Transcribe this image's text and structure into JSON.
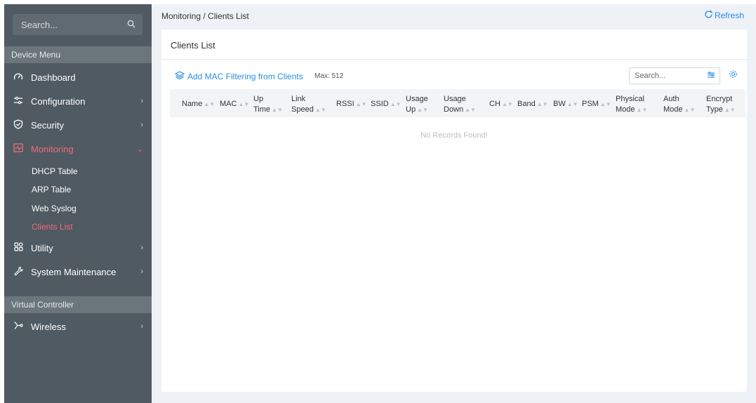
{
  "sidebar": {
    "search_placeholder": "Search...",
    "section_device": "Device Menu",
    "section_virtual": "Virtual Controller",
    "items": [
      {
        "label": "Dashboard",
        "icon": "dashboard-icon"
      },
      {
        "label": "Configuration",
        "icon": "sliders-icon"
      },
      {
        "label": "Security",
        "icon": "shield-icon"
      },
      {
        "label": "Monitoring",
        "icon": "monitor-icon"
      },
      {
        "label": "Utility",
        "icon": "grid-icon"
      },
      {
        "label": "System Maintenance",
        "icon": "wrench-icon"
      },
      {
        "label": "Wireless",
        "icon": "network-icon"
      }
    ],
    "subitems": [
      "DHCP Table",
      "ARP Table",
      "Web Syslog",
      "Clients List"
    ]
  },
  "header": {
    "breadcrumb": "Monitoring / Clients List",
    "refresh": "Refresh"
  },
  "panel": {
    "title": "Clients List",
    "add_mac": "Add MAC Filtering from Clients",
    "max": "Max: 512",
    "search_placeholder": "Search...",
    "empty": "No Records Found!"
  },
  "table": {
    "columns": [
      {
        "l1": "Name",
        "l2": ""
      },
      {
        "l1": "MAC",
        "l2": ""
      },
      {
        "l1": "Up",
        "l2": "Time"
      },
      {
        "l1": "Link",
        "l2": "Speed"
      },
      {
        "l1": "RSSI",
        "l2": ""
      },
      {
        "l1": "SSID",
        "l2": ""
      },
      {
        "l1": "Usage",
        "l2": "Up"
      },
      {
        "l1": "Usage",
        "l2": "Down"
      },
      {
        "l1": "CH",
        "l2": ""
      },
      {
        "l1": "Band",
        "l2": ""
      },
      {
        "l1": "BW",
        "l2": ""
      },
      {
        "l1": "PSM",
        "l2": ""
      },
      {
        "l1": "Physical",
        "l2": "Mode"
      },
      {
        "l1": "Auth",
        "l2": "Mode"
      },
      {
        "l1": "Encrypt",
        "l2": "Type"
      }
    ]
  },
  "colors": {
    "sidebar_bg": "#4f5a62",
    "accent": "#2a8ee0",
    "active": "#f06a7b"
  }
}
